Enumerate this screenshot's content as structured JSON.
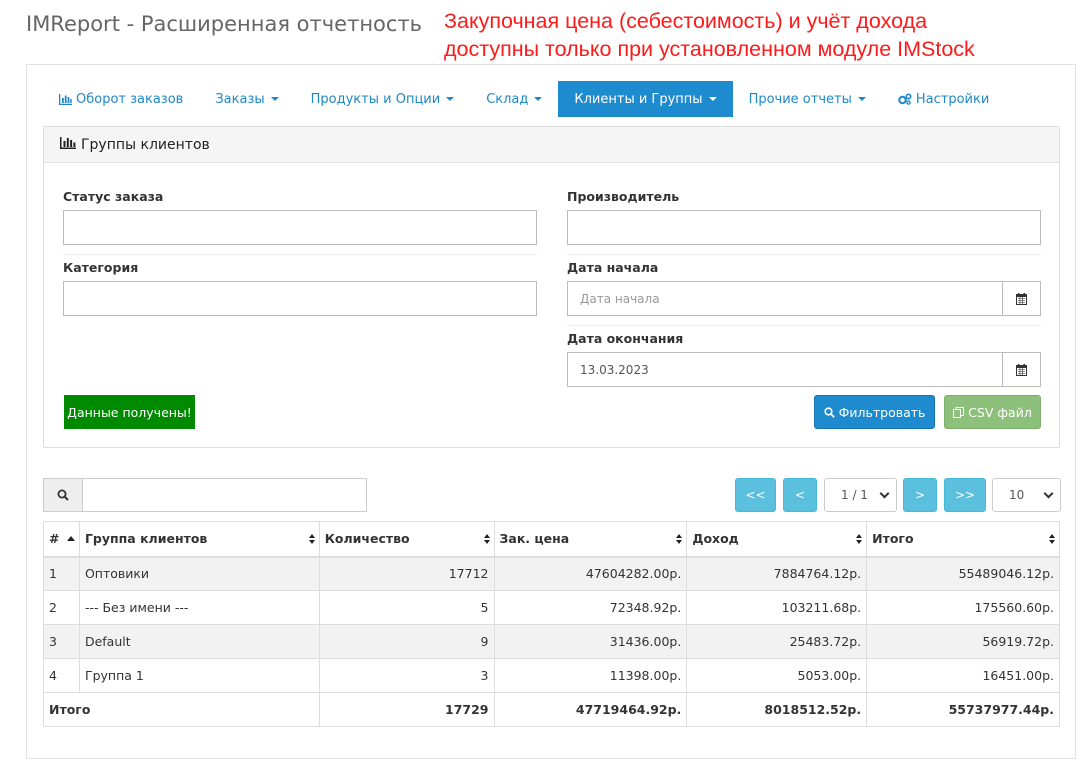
{
  "app": {
    "title": "IMReport - Расширенная отчетность",
    "notice_line1": "Закупочная цена (себестоимость) и учёт дохода",
    "notice_line2": "доступны только при установленном модуле IMStock"
  },
  "nav": {
    "items": [
      {
        "label": "Оборот заказов",
        "icon": "bar-chart-icon"
      },
      {
        "label": "Заказы"
      },
      {
        "label": "Продукты и Опции"
      },
      {
        "label": "Склад"
      },
      {
        "label": "Клиенты и Группы"
      },
      {
        "label": "Прочие отчеты"
      },
      {
        "label": "Настройки",
        "icon": "gears-icon"
      }
    ],
    "active": "Клиенты и Группы"
  },
  "filter": {
    "title": "Группы клиентов",
    "order_status_label": "Статус заказа",
    "order_status_value": "",
    "manufacturer_label": "Производитель",
    "manufacturer_value": "",
    "category_label": "Категория",
    "category_value": "",
    "start_date_label": "Дата начала",
    "start_date_placeholder": "Дата начала",
    "end_date_label": "Дата окончания",
    "end_date_value": "13.03.2023",
    "status_message": "Данные получены!",
    "filter_button": "Фильтровать",
    "csv_button": "CSV файл"
  },
  "colors": {
    "accent": "#1e8bcf",
    "success": "#008a00",
    "csv": "#8dc07a",
    "pager": "#5bc0de",
    "notice": "#ff1a1a"
  },
  "pager": {
    "first": "<<",
    "prev": "<",
    "page": "1 / 1",
    "next": ">",
    "last": ">>",
    "per_page": "10"
  },
  "table": {
    "columns": [
      "#",
      "Группа клиентов",
      "Количество",
      "Зак. цена",
      "Доход",
      "Итого"
    ],
    "rows": [
      [
        "1",
        "Оптовики",
        "17712",
        "47604282.00р.",
        "7884764.12р.",
        "55489046.12р."
      ],
      [
        "2",
        "--- Без имени ---",
        "5",
        "72348.92р.",
        "103211.68р.",
        "175560.60р."
      ],
      [
        "3",
        "Default",
        "9",
        "31436.00р.",
        "25483.72р.",
        "56919.72р."
      ],
      [
        "4",
        "Группа 1",
        "3",
        "11398.00р.",
        "5053.00р.",
        "16451.00р."
      ]
    ],
    "total": [
      "Итого",
      "17729",
      "47719464.92р.",
      "8018512.52р.",
      "55737977.44р."
    ]
  }
}
